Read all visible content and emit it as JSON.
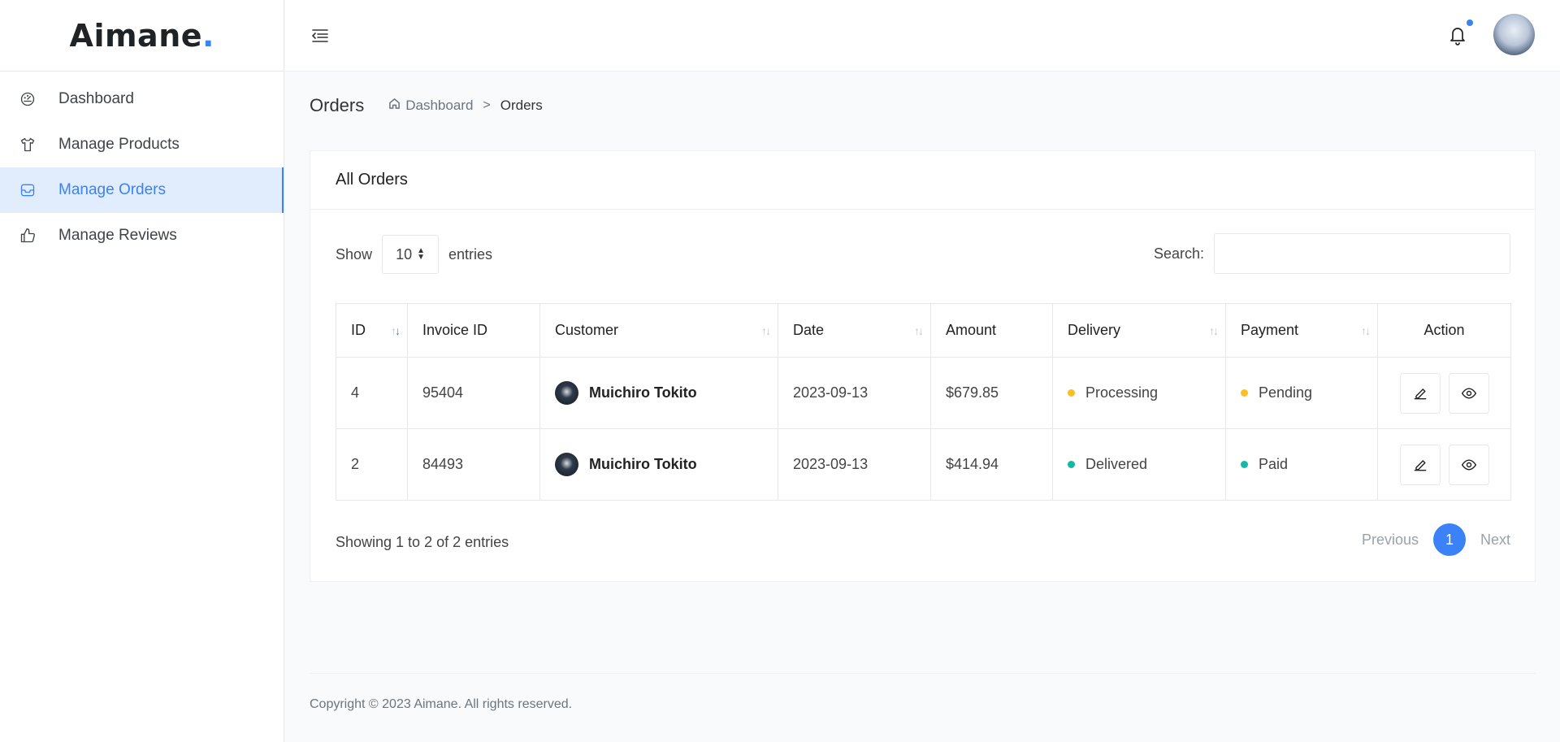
{
  "brand": {
    "name": "Aimane",
    "dot": "."
  },
  "sidebar": {
    "items": [
      {
        "label": "Dashboard",
        "icon": "dashboard-gauge-icon"
      },
      {
        "label": "Manage Products",
        "icon": "tshirt-icon"
      },
      {
        "label": "Manage Orders",
        "icon": "inbox-icon",
        "active": true
      },
      {
        "label": "Manage Reviews",
        "icon": "thumbs-up-icon"
      }
    ]
  },
  "header": {
    "menu_icon": "menu-toggle-icon",
    "notification_icon": "bell-icon"
  },
  "page": {
    "title": "Orders",
    "breadcrumb": {
      "home": "Dashboard",
      "separator": ">",
      "current": "Orders"
    }
  },
  "card": {
    "title": "All Orders",
    "show_label": "Show",
    "entries_value": "10",
    "entries_label": "entries",
    "search_label": "Search:",
    "search_value": ""
  },
  "table": {
    "columns": [
      "ID",
      "Invoice ID",
      "Customer",
      "Date",
      "Amount",
      "Delivery",
      "Payment",
      "Action"
    ],
    "rows": [
      {
        "id": "4",
        "invoice": "95404",
        "customer": "Muichiro Tokito",
        "date": "2023-09-13",
        "amount": "$679.85",
        "delivery": "Processing",
        "payment": "Pending"
      },
      {
        "id": "2",
        "invoice": "84493",
        "customer": "Muichiro Tokito",
        "date": "2023-09-13",
        "amount": "$414.94",
        "delivery": "Delivered",
        "payment": "Paid"
      }
    ]
  },
  "pagination": {
    "info": "Showing 1 to 2 of 2 entries",
    "previous": "Previous",
    "current": "1",
    "next": "Next"
  },
  "footer": {
    "text": "Copyright © 2023 Aimane. All rights reserved."
  },
  "colors": {
    "accent": "#3b82f6",
    "pending": "#fbbf24",
    "processing": "#fbbf24",
    "success": "#14b8a6"
  }
}
